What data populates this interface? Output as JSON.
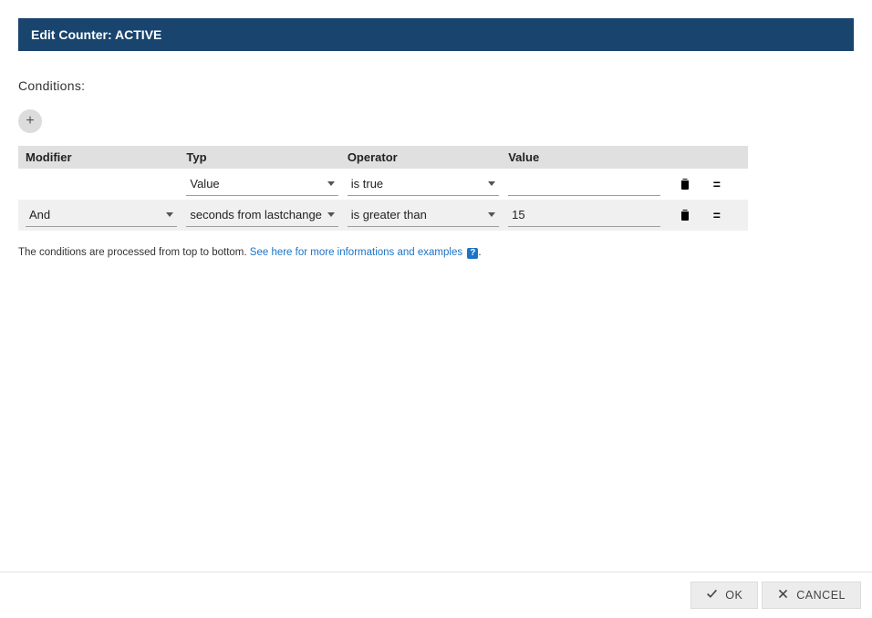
{
  "header": {
    "title": "Edit Counter: ACTIVE"
  },
  "section": {
    "conditions_label": "Conditions:"
  },
  "table": {
    "headers": {
      "modifier": "Modifier",
      "type": "Typ",
      "operator": "Operator",
      "value": "Value"
    },
    "rows": [
      {
        "modifier": "",
        "type": "Value",
        "operator": "is true",
        "value": ""
      },
      {
        "modifier": "And",
        "type": "seconds from lastchange",
        "operator": "is greater than",
        "value": "15"
      }
    ]
  },
  "hint": {
    "prefix": "The conditions are processed from top to bottom. ",
    "link": "See here for more informations and examples",
    "help": "?",
    "suffix": "."
  },
  "footer": {
    "ok": "OK",
    "cancel": "CANCEL"
  },
  "icons": {
    "plus": "+",
    "drag": "="
  }
}
